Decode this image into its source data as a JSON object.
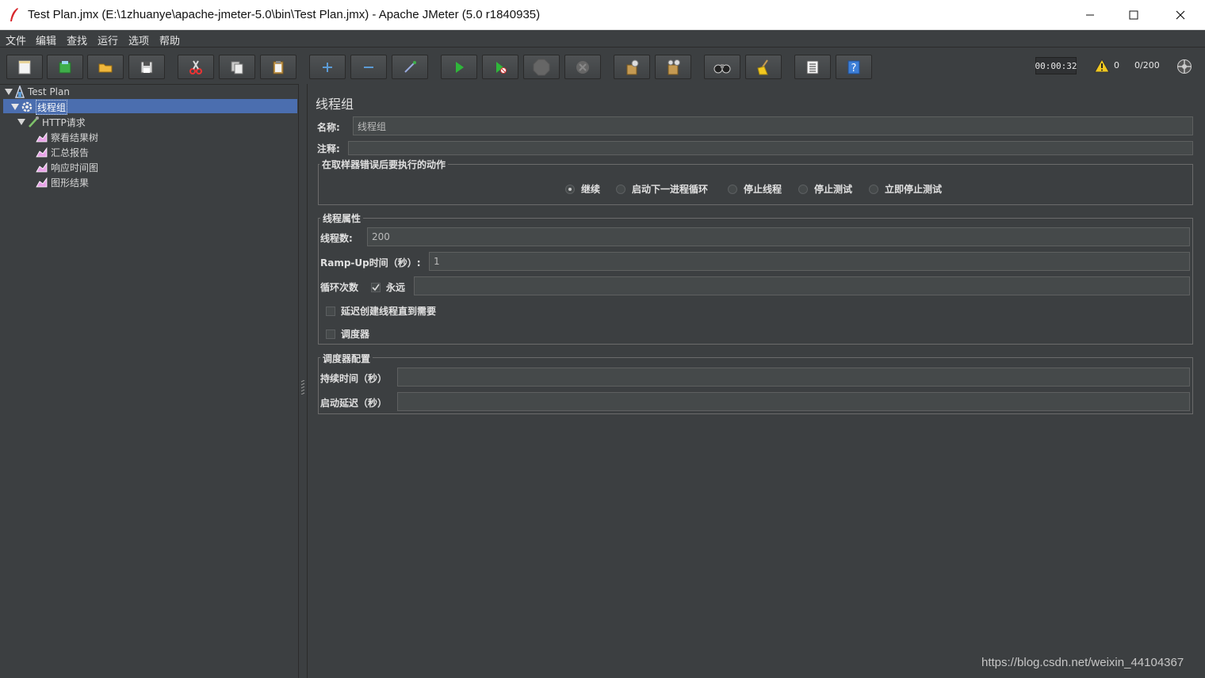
{
  "window": {
    "title": "Test Plan.jmx (E:\\1zhuanye\\apache-jmeter-5.0\\bin\\Test Plan.jmx) - Apache JMeter (5.0 r1840935)"
  },
  "menu": [
    "文件",
    "编辑",
    "查找",
    "运行",
    "选项",
    "帮助"
  ],
  "toolbar": {
    "timer": "00:00:32",
    "warnings": "0",
    "threads": "0/200"
  },
  "tree": {
    "items": [
      {
        "label": "Test Plan",
        "icon": "test-plan-icon"
      },
      {
        "label": "线程组",
        "icon": "gear-icon",
        "selected": true
      },
      {
        "label": "HTTP请求",
        "icon": "pipette-icon"
      },
      {
        "label": "察看结果树",
        "icon": "graph-icon"
      },
      {
        "label": "汇总报告",
        "icon": "graph-icon"
      },
      {
        "label": "响应时间图",
        "icon": "graph-icon"
      },
      {
        "label": "图形结果",
        "icon": "graph-icon"
      }
    ]
  },
  "form": {
    "title": "线程组",
    "name_label": "名称:",
    "name_value": "线程组",
    "comment_label": "注释:",
    "comment_value": "",
    "error_group_title": "在取样器错误后要执行的动作",
    "error_actions": [
      "继续",
      "启动下一进程循环",
      "停止线程",
      "停止测试",
      "立即停止测试"
    ],
    "selected_error_action": "继续",
    "thread_group_title": "线程属性",
    "threads_label": "线程数:",
    "threads_value": "200",
    "rampup_label": "Ramp-Up时间（秒）:",
    "rampup_value": "1",
    "loop_label": "循环次数",
    "forever_label": "永远",
    "forever_checked": true,
    "loop_value": "",
    "delay_label": "延迟创建线程直到需要",
    "delay_checked": false,
    "scheduler_label": "调度器",
    "scheduler_checked": false,
    "scheduler_group_title": "调度器配置",
    "duration_label": "持续时间（秒）",
    "duration_value": "",
    "startup_delay_label": "启动延迟（秒）",
    "startup_delay_value": ""
  },
  "watermark": "https://blog.csdn.net/weixin_44104367"
}
